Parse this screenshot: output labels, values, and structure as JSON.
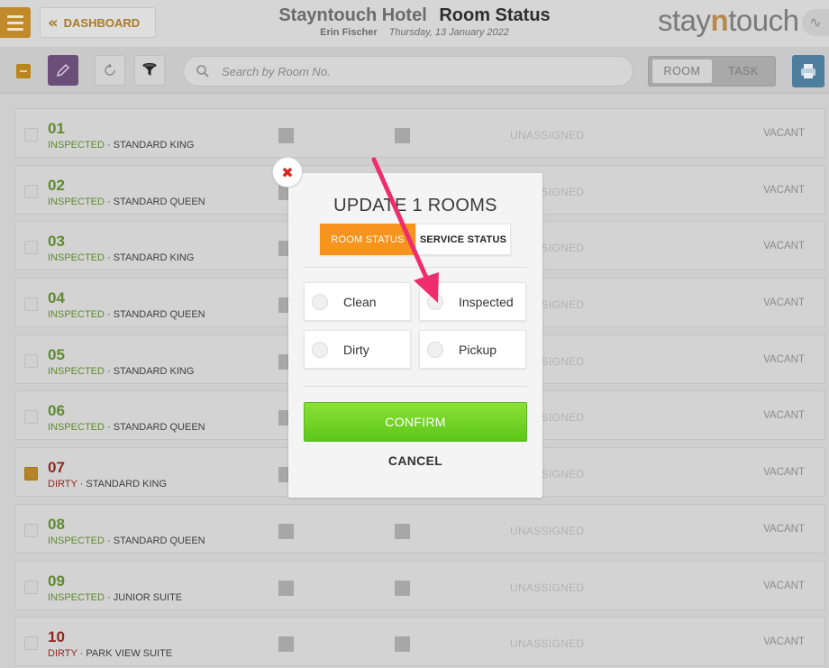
{
  "header": {
    "menu_icon": "hamburger-icon",
    "dashboard_label": "DASHBOARD",
    "hotel_name": "Stayntouch Hotel",
    "page_title": "Room Status",
    "user_name": "Erin Fischer",
    "date": "Thursday, 13 January 2022",
    "logo": {
      "pre": "stay",
      "mid": "n",
      "post": "touch"
    }
  },
  "toolbar": {
    "search_placeholder": "Search by Room No.",
    "view_toggle": {
      "room": "ROOM",
      "task": "TASK",
      "selected": "ROOM"
    }
  },
  "rooms": [
    {
      "number": "01",
      "status": "INSPECTED",
      "type": "STANDARD KING",
      "assignment": "UNASSIGNED",
      "occupancy": "VACANT",
      "checked": false
    },
    {
      "number": "02",
      "status": "INSPECTED",
      "type": "STANDARD QUEEN",
      "assignment": "UNASSIGNED",
      "occupancy": "VACANT",
      "checked": false
    },
    {
      "number": "03",
      "status": "INSPECTED",
      "type": "STANDARD KING",
      "assignment": "UNASSIGNED",
      "occupancy": "VACANT",
      "checked": false
    },
    {
      "number": "04",
      "status": "INSPECTED",
      "type": "STANDARD QUEEN",
      "assignment": "UNASSIGNED",
      "occupancy": "VACANT",
      "checked": false
    },
    {
      "number": "05",
      "status": "INSPECTED",
      "type": "STANDARD KING",
      "assignment": "UNASSIGNED",
      "occupancy": "VACANT",
      "checked": false
    },
    {
      "number": "06",
      "status": "INSPECTED",
      "type": "STANDARD QUEEN",
      "assignment": "UNASSIGNED",
      "occupancy": "VACANT",
      "checked": false
    },
    {
      "number": "07",
      "status": "DIRTY",
      "type": "STANDARD KING",
      "assignment": "UNASSIGNED",
      "occupancy": "VACANT",
      "checked": true
    },
    {
      "number": "08",
      "status": "INSPECTED",
      "type": "STANDARD QUEEN",
      "assignment": "UNASSIGNED",
      "occupancy": "VACANT",
      "checked": false
    },
    {
      "number": "09",
      "status": "INSPECTED",
      "type": "JUNIOR SUITE",
      "assignment": "UNASSIGNED",
      "occupancy": "VACANT",
      "checked": false
    },
    {
      "number": "10",
      "status": "DIRTY",
      "type": "PARK VIEW SUITE",
      "assignment": "UNASSIGNED",
      "occupancy": "VACANT",
      "checked": false
    }
  ],
  "modal": {
    "close_icon": "close-x-icon",
    "title": "UPDATE 1 ROOMS",
    "tabs": {
      "room_status": "ROOM STATUS",
      "service_status": "SERVICE STATUS",
      "selected": "ROOM STATUS"
    },
    "options": [
      "Clean",
      "Inspected",
      "Dirty",
      "Pickup"
    ],
    "confirm": "CONFIRM",
    "cancel": "CANCEL"
  },
  "colors": {
    "accent_orange": "#f7941d",
    "confirm_green": "#6ccf22",
    "inspected_green": "#5f8a2d",
    "dirty_red": "#8e2a22",
    "annotation_arrow": "#ee2d6e"
  }
}
